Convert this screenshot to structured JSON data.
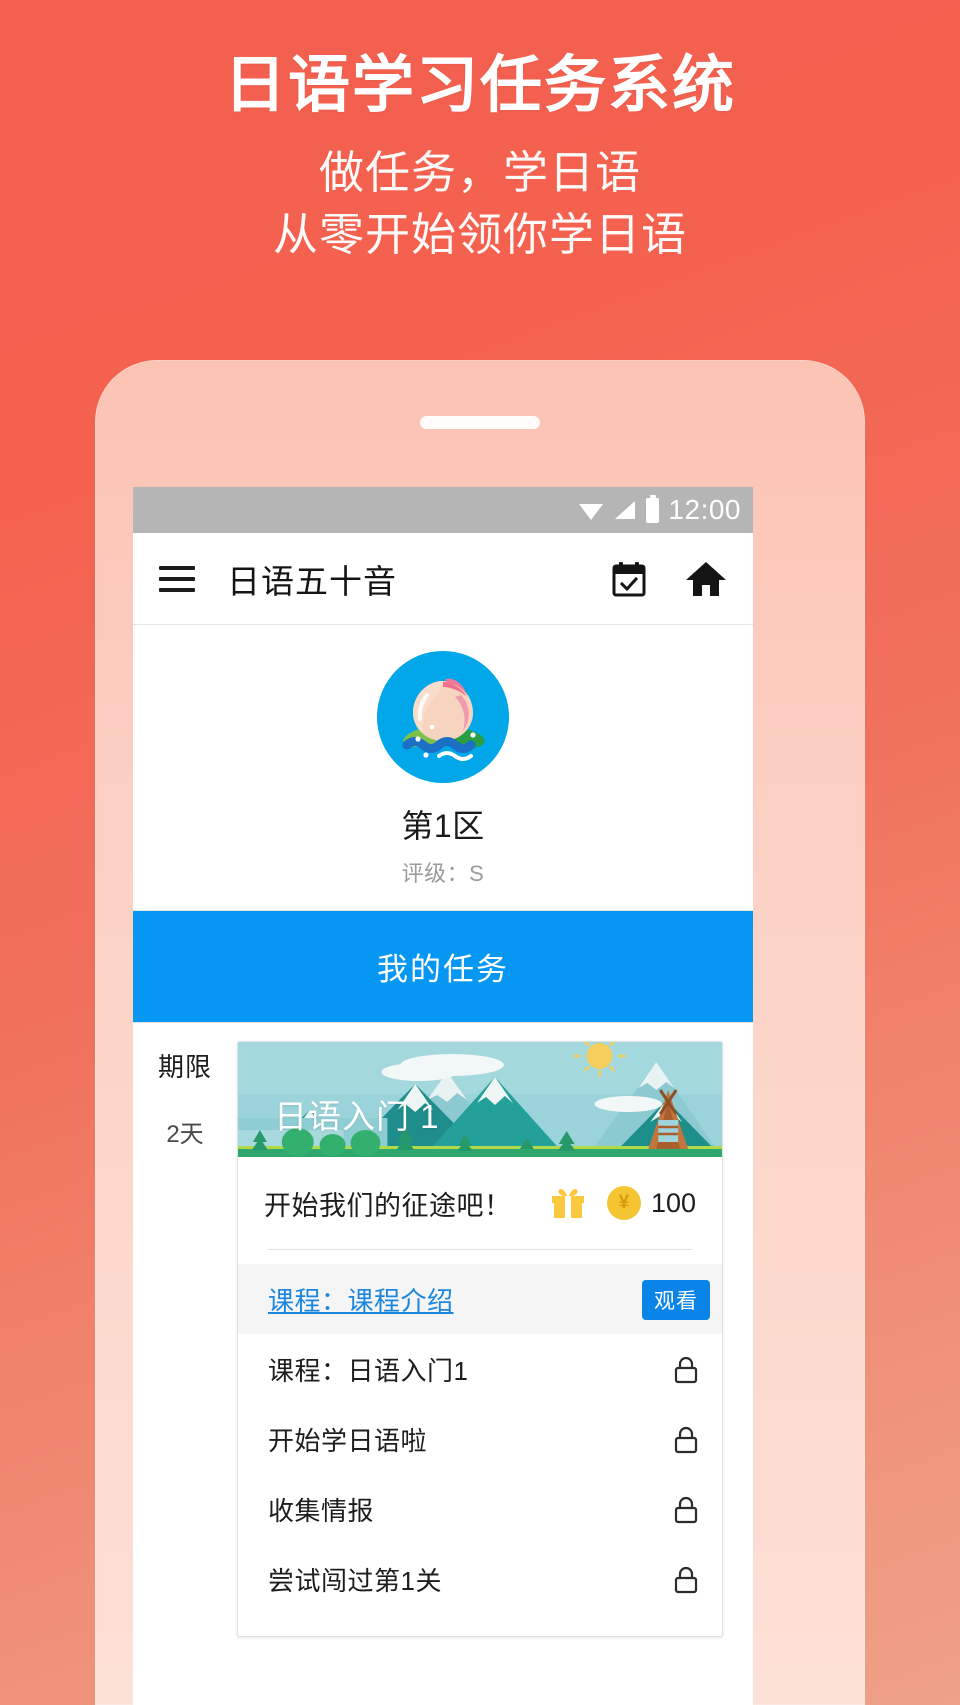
{
  "hero": {
    "title": "日语学习任务系统",
    "subtitle_line1": "做任务，学日语",
    "subtitle_line2": "从零开始领你学日语"
  },
  "statusbar": {
    "time": "12:00",
    "wifi_icon": "wifi-icon",
    "signal_icon": "signal-icon",
    "battery_icon": "battery-icon"
  },
  "appbar": {
    "menu_icon": "hamburger-menu-icon",
    "title": "日语五十音",
    "calendar_icon": "calendar-check-icon",
    "home_icon": "home-icon"
  },
  "region": {
    "avatar_icon": "peach-avatar-icon",
    "name": "第1区",
    "rank": "评级：S"
  },
  "cta": {
    "label": "我的任务",
    "color": "#0597f2"
  },
  "task": {
    "deadline_label": "期限",
    "deadline_value": "2天",
    "banner_title": "日语入门 1",
    "reward_text": "开始我们的征途吧！",
    "gift_icon": "gift-icon",
    "coin_icon": "coin-icon",
    "coin_value": "100",
    "lessons": [
      {
        "name": "课程：课程介绍",
        "state": "active",
        "action_label": "观看",
        "icon": ""
      },
      {
        "name": "课程：日语入门1",
        "state": "locked",
        "action_label": "",
        "icon": "lock-icon"
      },
      {
        "name": "开始学日语啦",
        "state": "locked",
        "action_label": "",
        "icon": "lock-icon"
      },
      {
        "name": "收集情报",
        "state": "locked",
        "action_label": "",
        "icon": "lock-icon"
      },
      {
        "name": "尝试闯过第1关",
        "state": "locked",
        "action_label": "",
        "icon": "lock-icon"
      }
    ]
  },
  "colors": {
    "background_start": "#f4604f",
    "background_end": "#efa189",
    "accent_blue": "#0597f2",
    "avatar_blue": "#01a7e8",
    "coin_gold": "#f5c432"
  }
}
